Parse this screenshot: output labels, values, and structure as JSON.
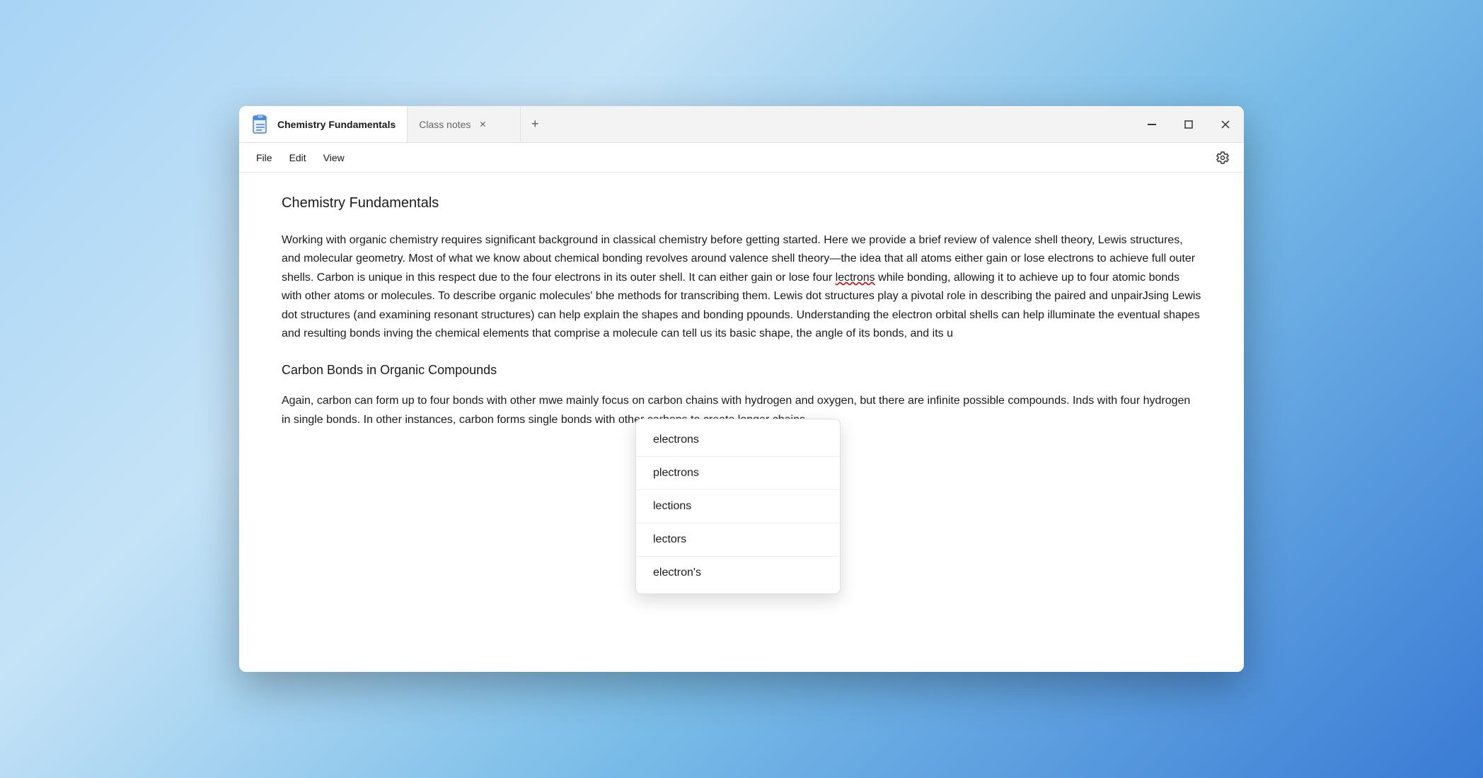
{
  "window": {
    "title": "Chemistry Fundamentals",
    "tabs": [
      {
        "label": "Chemistry Fundamentals",
        "active": true
      },
      {
        "label": "Class notes",
        "active": false
      }
    ],
    "controls": {
      "minimize": "—",
      "maximize": "□",
      "close": "✕"
    }
  },
  "menu": {
    "items": [
      "File",
      "Edit",
      "View"
    ],
    "settings_label": "⚙"
  },
  "document": {
    "title": "Chemistry Fundamentals",
    "paragraph1": "Working with organic chemistry requires significant background in classical chemistry before getting started. Here we provide a brief review of valence shell theory, Lewis structures, and molecular geometry. Most of what we know about chemical bonding revolves around valence shell theory—the idea that all atoms either gain or lose electrons to achieve full outer shells. Carbon is unique in this respect due to the four electrons in its outer shell. It can either gain or lose four lectrons while bonding, allowing it to achieve up to four atomic bonds with other atoms or molecules. To describe organic molecules' b",
    "paragraph1_mid": "he methods for transcribing them. Lewis dot structures play a pivotal role in describing the paired and unpair",
    "paragraph1_mid2": "Jsing Lewis dot structures (and examining resonant structures) can help explain the shapes and bonding p",
    "paragraph1_mid3": "pounds. Understanding the electron orbital shells can help illuminate the eventual shapes and resulting bonds in",
    "paragraph1_end": "ving the chemical elements that comprise a molecule can tell us its basic shape, the angle of its bonds, and its u",
    "heading1": "Carbon Bonds in Organic Compounds",
    "paragraph2_start": "Again, carbon can form up to four bonds with other m",
    "paragraph2_mid": "we mainly focus on carbon chains with hydrogen and oxygen, but there are infinite possible compounds. In",
    "paragraph2_mid2": "ds with four hydrogen in single bonds. In other instances, carbon forms single bonds with other carbons to create longer chains.",
    "misspelled_word": "lectrons"
  },
  "autocorrect": {
    "items": [
      "electrons",
      "plectrons",
      "lections",
      "lectors",
      "electron's"
    ]
  },
  "icons": {
    "notepad": "📝",
    "settings": "⚙",
    "minimize": "minimize-icon",
    "maximize": "maximize-icon",
    "close_window": "close-window-icon",
    "tab_close": "tab-close-icon",
    "tab_add": "tab-add-icon"
  }
}
